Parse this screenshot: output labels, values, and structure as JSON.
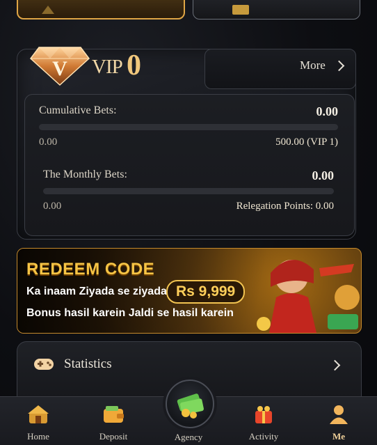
{
  "top_buttons": {
    "left": "",
    "right": ""
  },
  "vip": {
    "label": "VIP",
    "level": "0",
    "more_label": "More",
    "cumulative": {
      "label": "Cumulative Bets:",
      "value": "0.00",
      "min": "0.00",
      "max": "500.00 (VIP 1)",
      "progress": 0
    },
    "monthly": {
      "label": "The Monthly Bets:",
      "value": "0.00",
      "min": "0.00",
      "relegation": "Relegation Points: 0.00",
      "progress": 0
    }
  },
  "banner": {
    "title": "REDEEM CODE",
    "line1": "Ka inaam Ziyada se ziyada",
    "amount": "Rs 9,999",
    "line2": "Bonus hasil karein Jaldi se hasil karein"
  },
  "statistics": {
    "label": "Statistics"
  },
  "nav": {
    "home": "Home",
    "deposit": "Deposit",
    "agency": "Agency",
    "activity": "Activity",
    "me": "Me"
  },
  "colors": {
    "gold": "#f0c77c",
    "banner_accent": "#f6c445",
    "panel": "#17181c"
  },
  "icons": [
    "vip-gem-icon",
    "chevron-right-icon",
    "gamepad-icon",
    "home-icon",
    "wallet-icon",
    "money-icon",
    "gift-icon",
    "user-icon"
  ]
}
